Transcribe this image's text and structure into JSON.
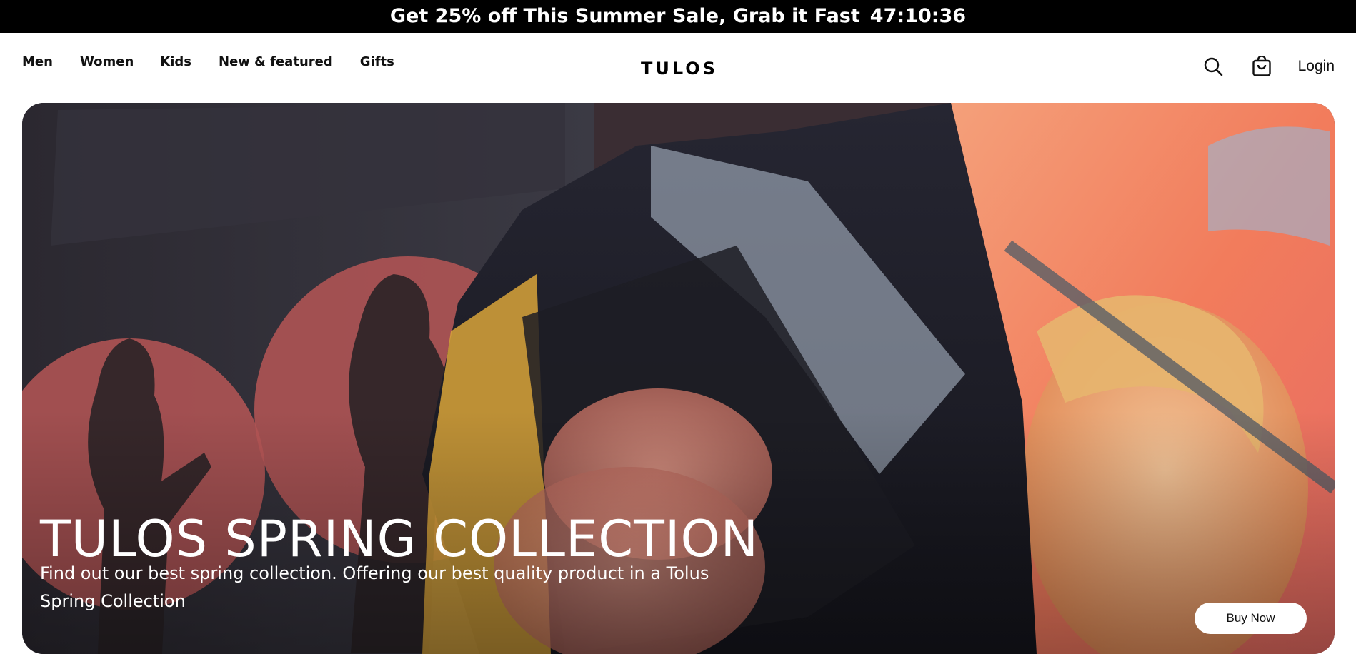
{
  "promo": {
    "text": "Get 25% off This Summer Sale, Grab it Fast",
    "countdown": "47:10:36"
  },
  "nav": {
    "links": [
      "Men",
      "Women",
      "Kids",
      "New & featured",
      "Gifts"
    ],
    "logo": "TULOS",
    "login_label": "Login",
    "icons": [
      "search-icon",
      "shopping-bag-icon"
    ]
  },
  "hero": {
    "title": "TULOS SPRING COLLECTION",
    "description": "Find out our best spring collection. Offering our best quality product in a Tolus Spring Collection",
    "button_label": "Buy Now"
  },
  "colors": {
    "promo_bg": "#000000",
    "text_primary": "#111111",
    "hero_text": "#ffffff"
  }
}
